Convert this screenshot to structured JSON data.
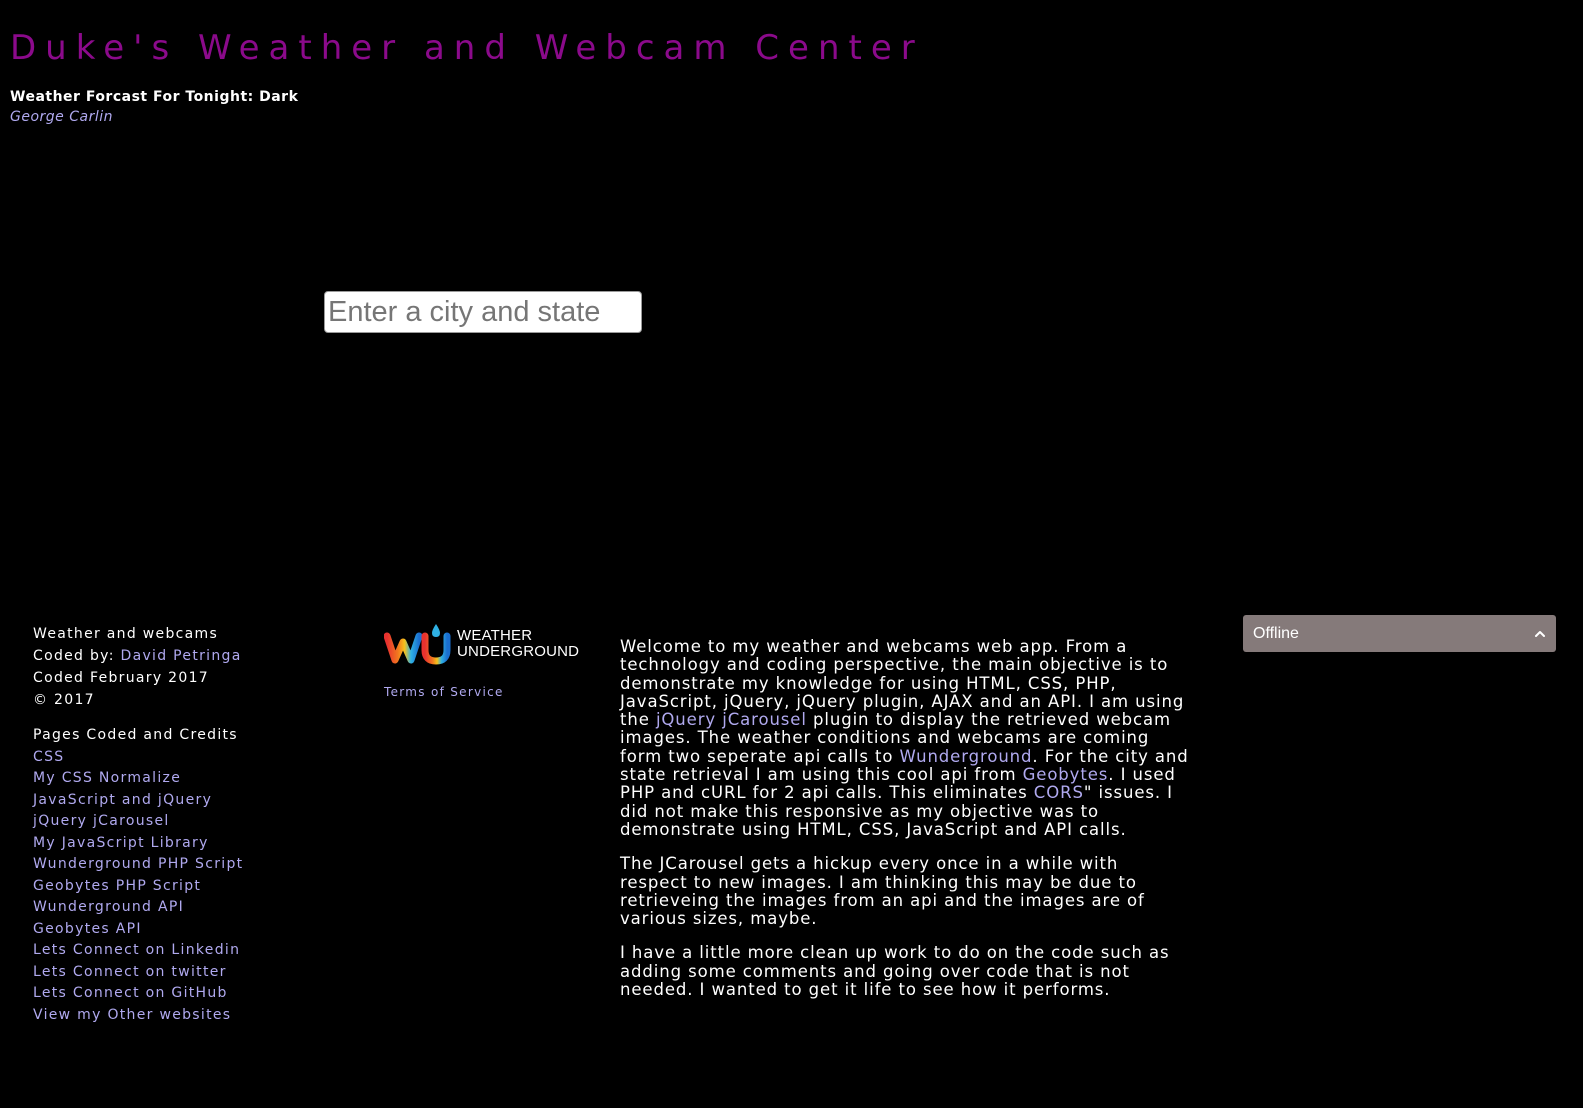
{
  "header": {
    "title": "Duke's Weather and Webcam Center",
    "quote_text": "Weather Forcast For Tonight: Dark",
    "quote_author": "George Carlin"
  },
  "search": {
    "placeholder": "Enter a city and state",
    "value": ""
  },
  "footer_left": {
    "line1": "Weather and webcams",
    "coded_by_prefix": "Coded by: ",
    "coded_by_name": "David Petringa",
    "coded_date": "Coded February 2017",
    "copyright": "©  2017",
    "links_heading": "Pages Coded and Credits",
    "links": [
      "CSS",
      "My CSS Normalize",
      "JavaScript and jQuery",
      "jQuery jCarousel",
      "My JavaScript Library",
      "Wunderground PHP Script",
      "Geobytes PHP Script",
      "Wunderground API",
      "Geobytes API",
      "Lets Connect on Linkedin",
      "Lets Connect on twitter",
      "Lets Connect on GitHub",
      "View my Other websites"
    ]
  },
  "wunderground": {
    "logo_line1": "WEATHER",
    "logo_line2": "UNDERGROUND",
    "terms_label": "Terms of Service"
  },
  "about": {
    "p1_a": "Welcome to my weather and webcams web app. From a technology and coding perspective, the main objective is to demonstrate my knowledge for using HTML, CSS, PHP, JavaScript, jQuery, jQuery plugin, AJAX and an API. I am using the ",
    "p1_link1": "jQuery jCarousel",
    "p1_b": " plugin to display the retrieved webcam images. The weather conditions and webcams are coming form two seperate api calls to ",
    "p1_link2": "Wunderground",
    "p1_c": ". For the city and state retrieval I am using this cool api from ",
    "p1_link3": "Geobytes",
    "p1_d": ". I used PHP and cURL for 2 api calls. This eliminates ",
    "p1_link4": "CORS",
    "p1_e": "\" issues. I did not make this responsive as my objective was to demonstrate using HTML, CSS, JavaScript and API calls.",
    "p2": "The JCarousel gets a hickup every once in a while with respect to new images. I am thinking this may be due to retrieveing the images from an api and the images are of various sizes, maybe.",
    "p3": "I have a little more clean up work to do on the code such as adding some comments and going over code that is not needed. I wanted to get it life to see how it performs."
  },
  "chat": {
    "status_label": "Offline",
    "icon": "chevron-up-icon"
  },
  "colors": {
    "title": "#8b0a8b",
    "link": "#b0a9ef",
    "background": "#000000",
    "chat_bar": "#857a7a"
  }
}
